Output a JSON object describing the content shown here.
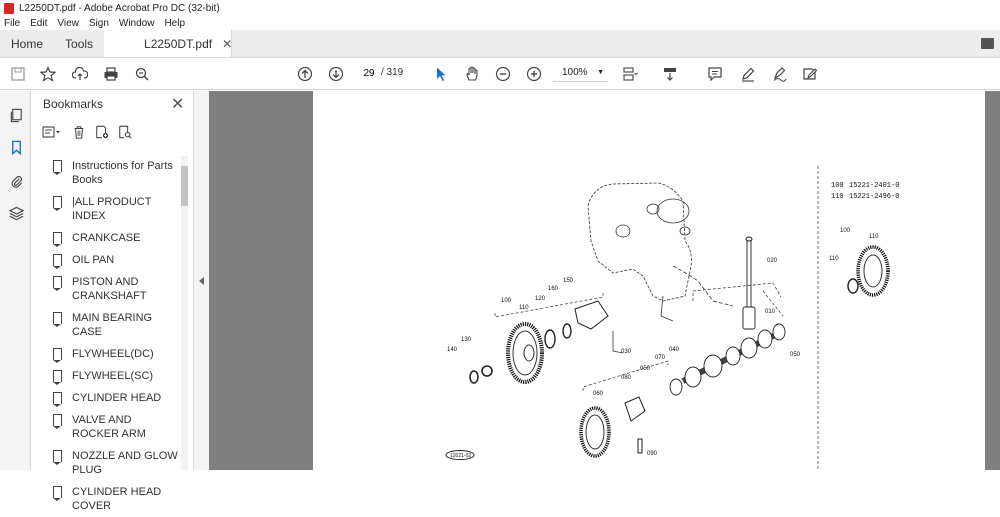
{
  "window": {
    "title": "L2250DT.pdf - Adobe Acrobat Pro DC (32-bit)"
  },
  "menu": [
    "File",
    "Edit",
    "View",
    "Sign",
    "Window",
    "Help"
  ],
  "tabs": {
    "home": "Home",
    "tools": "Tools",
    "document": "L2250DT.pdf"
  },
  "toolbar": {
    "current_page": "29",
    "page_total": "/ 319",
    "zoom": "100%"
  },
  "bookmarks": {
    "title": "Bookmarks",
    "items": [
      "Instructions for Parts Books",
      "|ALL PRODUCT INDEX",
      "CRANKCASE",
      "OIL PAN",
      "PISTON AND CRANKSHAFT",
      "MAIN BEARING CASE",
      "FLYWHEEL(DC)",
      "FLYWHEEL(SC)",
      "CYLINDER HEAD",
      "VALVE AND ROCKER ARM",
      "NOZZLE AND GLOW PLUG",
      "CYLINDER HEAD COVER"
    ]
  },
  "diagram": {
    "part_numbers": [
      {
        "ref": "100",
        "part": "15221-2401-0"
      },
      {
        "ref": "110",
        "part": "15221-2496-0"
      }
    ],
    "callouts": [
      "010",
      "020",
      "030",
      "040",
      "050",
      "050",
      "060",
      "070",
      "080",
      "090",
      "100",
      "110",
      "120",
      "130",
      "140",
      "150",
      "160",
      "100",
      "110",
      "110"
    ],
    "stamp": "12021-02"
  }
}
